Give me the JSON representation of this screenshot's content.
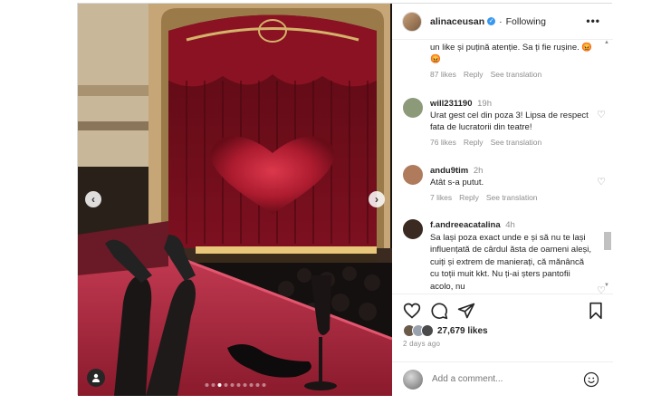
{
  "post": {
    "username": "alinaceusan",
    "follow_label": "Following",
    "more_label": "•••",
    "verified_mark": "✓"
  },
  "media": {
    "prev_label": "‹",
    "next_label": "›",
    "slide_count": 10,
    "active_slide": 2
  },
  "comments": [
    {
      "username": "",
      "time": "",
      "text": "un like și puțină atenție. Sa ți fie rușine. 😡😡",
      "likes": "87 likes",
      "reply": "Reply",
      "translate": "See translation",
      "avatar_color": "#ffffff"
    },
    {
      "username": "will231190",
      "time": "19h",
      "text": "Urat gest cel din poza 3! Lipsa de respect fata de lucratorii din teatre!",
      "likes": "76 likes",
      "reply": "Reply",
      "translate": "See translation",
      "avatar_color": "#8c9a7a"
    },
    {
      "username": "andu9tim",
      "time": "2h",
      "text": "Atât s-a putut.",
      "likes": "7 likes",
      "reply": "Reply",
      "translate": "See translation",
      "avatar_color": "#b07b5c"
    },
    {
      "username": "f.andreeacatalina",
      "time": "4h",
      "text": "Sa lași poza exact unde e și să nu te lași influențată de cârdul ăsta de oameni aleși, cuiți și extrem de manierați, că mănâncă cu toții muit kkt. Nu ți-ai șters pantofii acolo, nu",
      "likes": "",
      "reply": "",
      "translate": "",
      "avatar_color": "#3a2a22"
    }
  ],
  "actions": {
    "likes_count": "27,679 likes",
    "time_ago": "2 days ago",
    "comment_placeholder": "Add a comment..."
  },
  "colors": {
    "verified_blue": "#3897f0",
    "text_primary": "#262626",
    "text_secondary": "#8e8e8e",
    "curtain_red": "#7a0f1c"
  },
  "icons": [
    "heart-icon",
    "comment-icon",
    "share-icon",
    "bookmark-icon",
    "emoji-icon",
    "more-icon",
    "user-tag-icon"
  ]
}
